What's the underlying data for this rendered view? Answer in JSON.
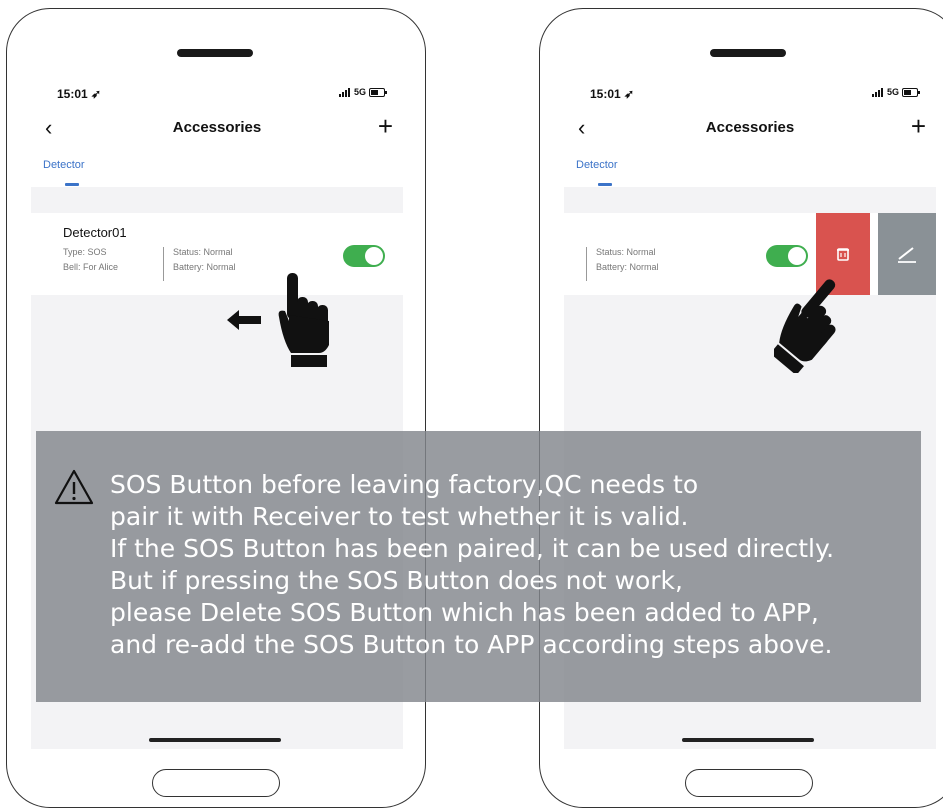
{
  "phones": [
    {
      "time": "15:01",
      "network": "5G",
      "title": "Accessories",
      "back_icon": "chevron-left-icon",
      "add_icon": "plus-icon",
      "tab": "Detector",
      "device": {
        "name": "Detector01",
        "type": "Type: SOS",
        "bell": "Bell: For Alice",
        "status": "Status: Normal",
        "battery": "Battery: Normal",
        "enabled": true
      },
      "gesture": "swipe-left-hand-icon"
    },
    {
      "time": "15:01",
      "network": "5G",
      "title": "Accessories",
      "back_icon": "chevron-left-icon",
      "add_icon": "plus-icon",
      "tab": "Detector",
      "device": {
        "status": "Status: Normal",
        "battery": "Battery: Normal",
        "enabled": true
      },
      "delete_icon": "trash-icon",
      "edit_icon": "pencil-icon",
      "gesture": "tap-hand-icon"
    }
  ],
  "notice": {
    "icon": "warning-icon",
    "lines": [
      "SOS Button before leaving factory,QC needs to",
      "pair it with Receiver to test whether it is valid.",
      "If the SOS Button has been paired, it can be used directly.",
      "But if pressing the SOS Button does not work,",
      "please Delete SOS Button which has been added to APP,",
      "and re-add the SOS Button to APP according steps above."
    ]
  },
  "colors": {
    "accent": "#3b73c8",
    "toggle_on": "#3fae4f",
    "delete": "#d9534f",
    "edit": "#8a9196",
    "overlay": "#82868c"
  }
}
